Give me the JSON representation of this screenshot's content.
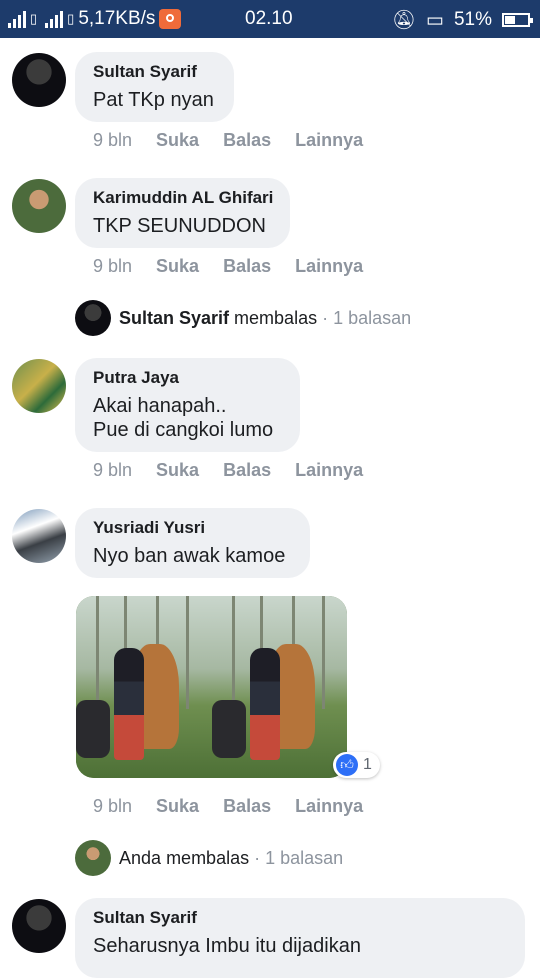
{
  "status_bar": {
    "speed": "5,17KB/s",
    "time": "02.10",
    "battery": "51%"
  },
  "comments": [
    {
      "name": "Sultan Syarif",
      "text": "Pat TKp nyan",
      "time": "9 bln"
    },
    {
      "name": "Karimuddin AL Ghifari",
      "text": "TKP SEUNUDDON",
      "time": "9 bln"
    },
    {
      "name": "Putra Jaya",
      "text_lines": [
        "Akai hanapah..",
        "Pue di cangkoi lumo"
      ],
      "time": "9 bln"
    },
    {
      "name": "Yusriadi Yusri",
      "text": "Nyo ban awak kamoe",
      "time": "9 bln",
      "like_count": "1"
    },
    {
      "name": "Sultan Syarif",
      "text": "Seharusnya Imbu itu dijadikan"
    }
  ],
  "actions": {
    "like": "Suka",
    "reply": "Balas",
    "more": "Lainnya"
  },
  "replies": [
    {
      "name": "Sultan Syarif",
      "verb": "membalas",
      "count": "· 1 balasan"
    },
    {
      "name": "Anda",
      "verb": "membalas",
      "count": "· 1 balasan"
    }
  ]
}
